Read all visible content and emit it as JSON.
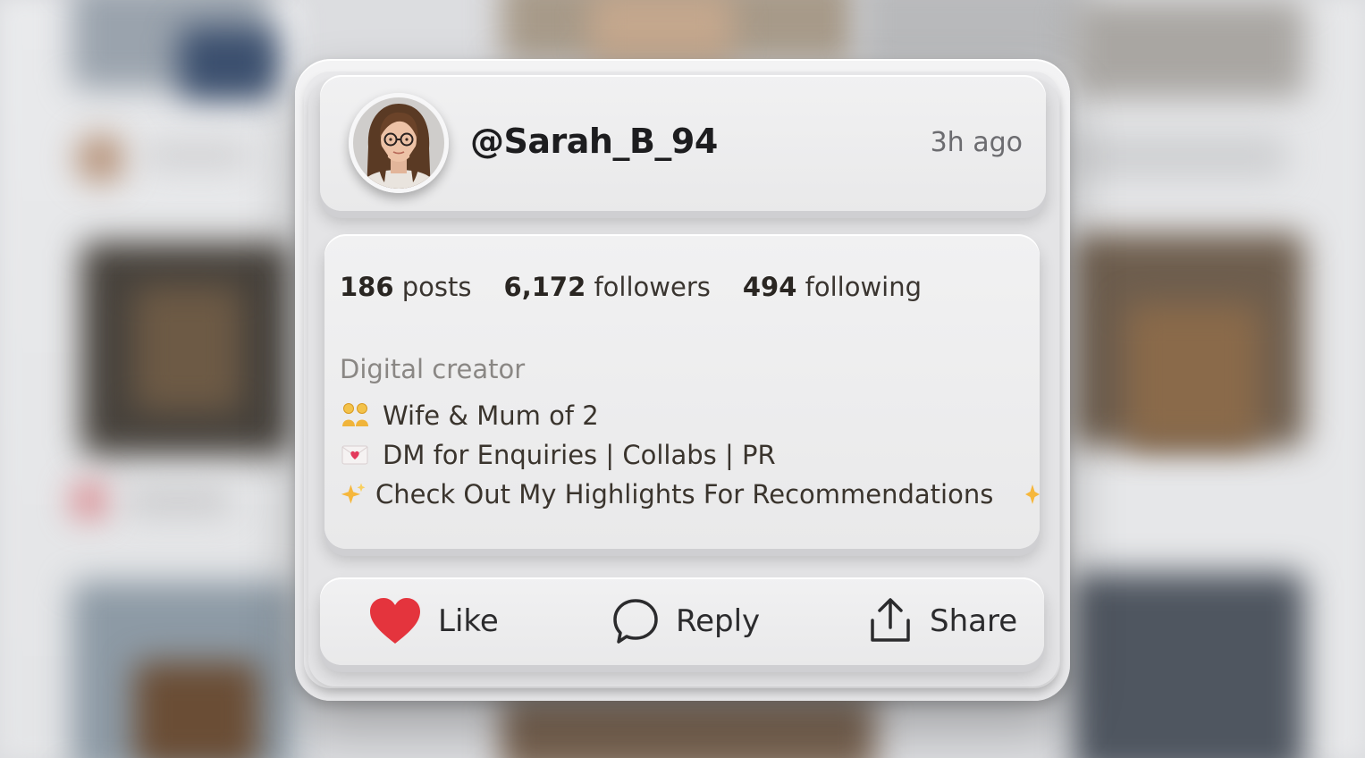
{
  "post": {
    "username": "@Sarah_B_94",
    "timestamp": "3h ago"
  },
  "profile": {
    "stats": {
      "posts_count": "186",
      "posts_label": "posts",
      "followers_count": "6,172",
      "followers_label": "followers",
      "following_count": "494",
      "following_label": "following"
    },
    "category": "Digital creator",
    "bio": [
      {
        "icon": "family-emoji-icon",
        "text": "Wife & Mum of 2"
      },
      {
        "icon": "love-letter-emoji-icon",
        "text": "DM for Enquiries | Collabs | PR"
      },
      {
        "icon": "sparkles-emoji-icon",
        "text": "Check Out My Highlights For Recommendations"
      }
    ]
  },
  "actions": {
    "like_label": "Like",
    "reply_label": "Reply",
    "share_label": "Share"
  },
  "colors": {
    "like_heart": "#e4343d",
    "text_primary": "#1d1d1f",
    "text_muted": "#6c6c70"
  }
}
